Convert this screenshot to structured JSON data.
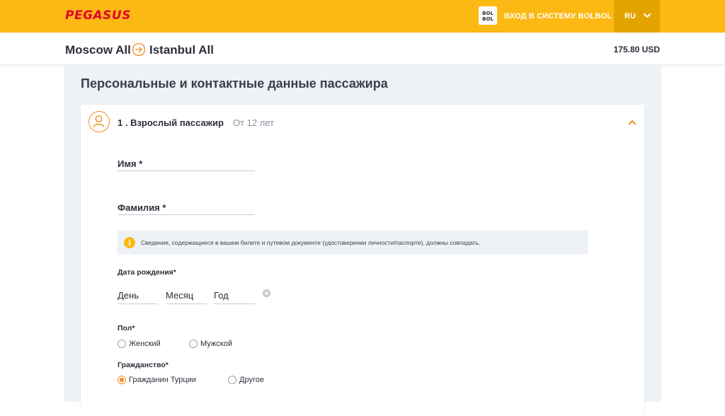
{
  "header": {
    "brand": "PEGASUS",
    "bolbol_logo": "BOL BOL",
    "login_label": "ВХОД В СИСТЕМУ BOLBOL",
    "language": "RU",
    "brand_color": "#e3002b",
    "accent_color": "#fcb813"
  },
  "route": {
    "from": "Moscow All",
    "to": "Istanbul All",
    "price": "175.80 USD"
  },
  "form": {
    "section_title": "Персональные и контактные данные пассажира",
    "passenger": {
      "title": "1 . Взрослый пассажир",
      "age_note": "От 12 лет"
    },
    "first_name_label": "Имя *",
    "last_name_label": "Фамилия *",
    "notice": "Сведения, содержащиеся в вашем билете и путевом документе (удостоверении личности/паспорте), должны совпадать.",
    "dob_label": "Дата рождения*",
    "dob": {
      "day": "День",
      "month": "Месяц",
      "year": "Год"
    },
    "gender_label": "Пол*",
    "gender_options": [
      "Женский",
      "Мужской"
    ],
    "citizenship_label": "Гражданство*",
    "citizenship_options": [
      "Гражданин Турции",
      "Другое"
    ],
    "citizenship_selected": "Гражданин Турции"
  },
  "icons": [
    "bolbol-icon",
    "chevron-down-icon",
    "arrow-right-circle-icon",
    "user-icon",
    "chevron-up-icon",
    "info-icon",
    "clear-icon"
  ]
}
